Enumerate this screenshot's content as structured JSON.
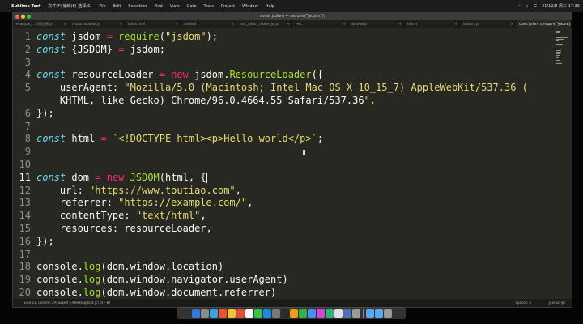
{
  "menubar": {
    "app_name": "Sublime Text",
    "items": [
      "文件(F) 编辑(E) 选择(S)",
      "File",
      "Edit",
      "Selection",
      "Find",
      "View",
      "Goto",
      "Tools",
      "Project",
      "Window",
      "Help"
    ],
    "status": "21/12/8 周三 17:36"
  },
  "window": {
    "title": "const jsdom = require(\"jsdom\");",
    "tabs": [
      "example_... 代码注释.js",
      "resourceloader.js",
      "index.html",
      "untitled",
      "test_jsdom_cookie_jar.js",
      "rest",
      "window.js",
      "test.js",
      "loaders.js",
      "const jsdom = require(\"jsdom\");"
    ],
    "active_tab": 9
  },
  "editor": {
    "current_line": 11,
    "lines": [
      {
        "n": "1",
        "text": "const jsdom = require(\"jsdom\");"
      },
      {
        "n": "2",
        "text": "const {JSDOM} = jsdom;"
      },
      {
        "n": "3",
        "text": ""
      },
      {
        "n": "4",
        "text": "const resourceLoader = new jsdom.ResourceLoader({"
      },
      {
        "n": "5",
        "text": "    userAgent: \"Mozilla/5.0 (Macintosh; Intel Mac OS X 10_15_7) AppleWebKit/537.36 ("
      },
      {
        "n": "",
        "text": "    KHTML, like Gecko) Chrome/96.0.4664.55 Safari/537.36\","
      },
      {
        "n": "6",
        "text": "});"
      },
      {
        "n": "7",
        "text": ""
      },
      {
        "n": "8",
        "text": "const html = `<!DOCTYPE html><p>Hello world</p>`;"
      },
      {
        "n": "9",
        "text": ""
      },
      {
        "n": "10",
        "text": ""
      },
      {
        "n": "11",
        "text": "const dom = new JSDOM(html, {"
      },
      {
        "n": "12",
        "text": "    url: \"https://www.toutiao.com\","
      },
      {
        "n": "13",
        "text": "    referrer: \"https://example.com/\","
      },
      {
        "n": "14",
        "text": "    contentType: \"text/html\","
      },
      {
        "n": "15",
        "text": "    resources: resourceLoader,"
      },
      {
        "n": "16",
        "text": "});"
      },
      {
        "n": "17",
        "text": ""
      },
      {
        "n": "18",
        "text": "console.log(dom.window.location)"
      },
      {
        "n": "19",
        "text": "console.log(dom.window.navigator.userAgent)"
      },
      {
        "n": "20",
        "text": "console.log(dom.window.document.referrer)"
      }
    ]
  },
  "statusbar": {
    "left": "Line 11, Column 29; Saved ~/Desktop/test.js (UTF-8)",
    "spaces": "Spaces: 4",
    "syntax": "JavaScript"
  },
  "colors": {
    "background": "#272822",
    "foreground": "#f8f8f2",
    "keyword": "#66d9ef",
    "operator": "#f92672",
    "function": "#a6e22e",
    "string": "#e6db74",
    "gutter": "#8f908a"
  }
}
